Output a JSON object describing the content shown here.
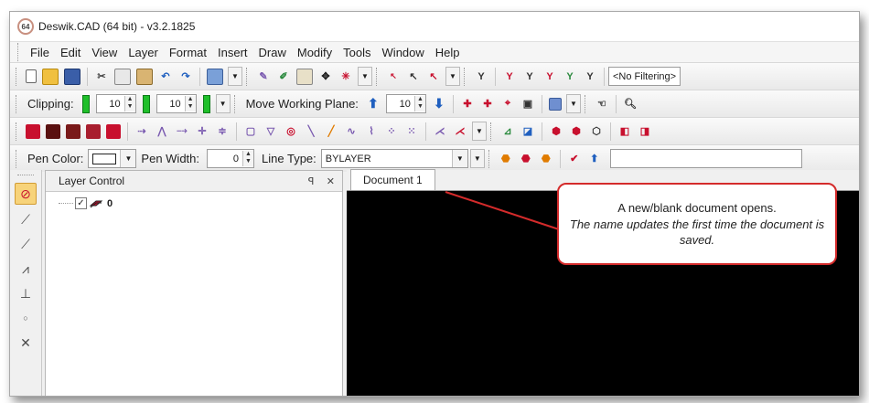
{
  "window": {
    "title": "Deswik.CAD (64 bit) - v3.2.1825",
    "icon_text": "64"
  },
  "menu": [
    "File",
    "Edit",
    "View",
    "Layer",
    "Format",
    "Insert",
    "Draw",
    "Modify",
    "Tools",
    "Window",
    "Help"
  ],
  "toolbar_standard": {
    "filter_value": "<No Filtering>"
  },
  "toolbar_clipping": {
    "clipping_label": "Clipping:",
    "clip_value_1": "10",
    "clip_value_2": "10",
    "move_plane_label": "Move Working Plane:",
    "plane_value": "10"
  },
  "toolbar_pen": {
    "pen_color_label": "Pen Color:",
    "pen_width_label": "Pen Width:",
    "pen_width_value": "0",
    "line_type_label": "Line Type:",
    "line_type_value": "BYLAYER"
  },
  "layer_panel": {
    "title": "Layer Control",
    "pin_glyph": "ꟼ",
    "close_glyph": "✕",
    "layer_name": "0",
    "checked": true
  },
  "document": {
    "tab_label": "Document 1",
    "canvas_color": "#000000"
  },
  "callout": {
    "line1": "A new/blank document opens.",
    "line2": "The name updates the first time the document is saved.",
    "border_color": "#d42b2b"
  },
  "colors": {
    "accent_red": "#c8102e",
    "accent_blue": "#1f5fbf",
    "accent_green": "#1fbf2a"
  }
}
